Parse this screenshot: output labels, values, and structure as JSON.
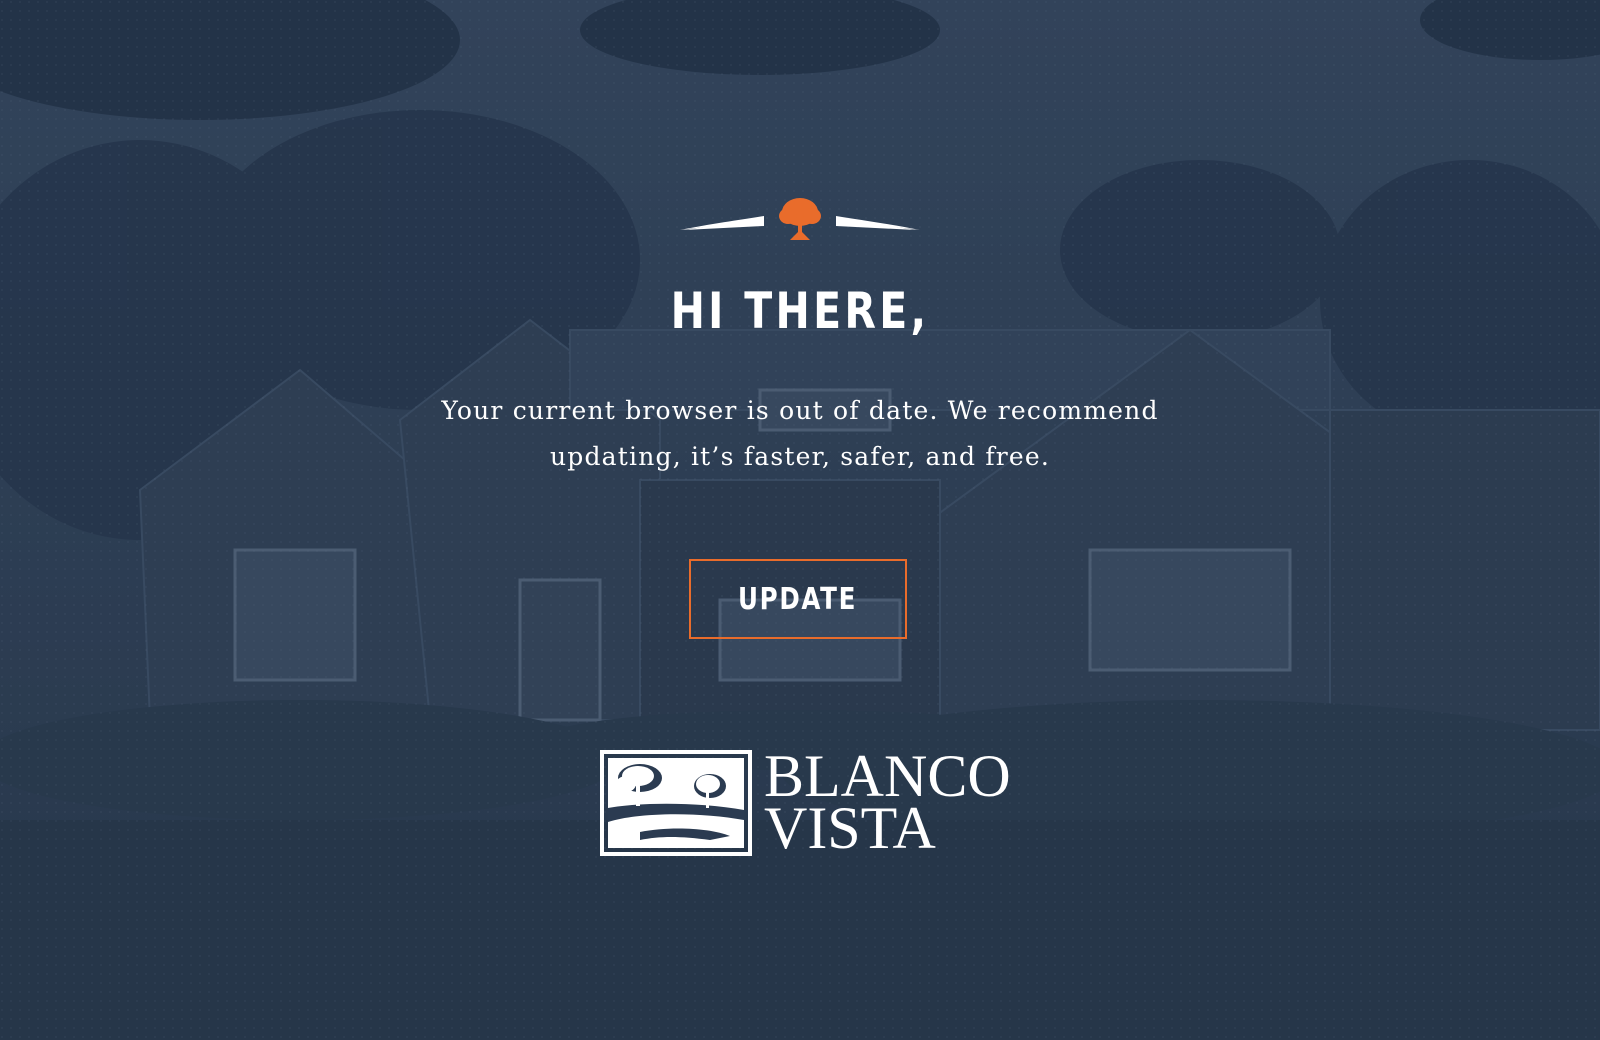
{
  "page": {
    "headline": "HI THERE,",
    "message": "Your current browser is out of date. We recommend updating, it’s faster, safer, and free.",
    "update_button_label": "UPDATE"
  },
  "brand": {
    "name_line1": "BLANCO",
    "name_line2": "VISTA"
  },
  "icons": {
    "top_emblem": "orange-tree-icon",
    "brand_mark": "trees-landscape-icon"
  },
  "colors": {
    "overlay": "#2b3b51",
    "accent": "#e96c2b",
    "text": "#ffffff"
  }
}
